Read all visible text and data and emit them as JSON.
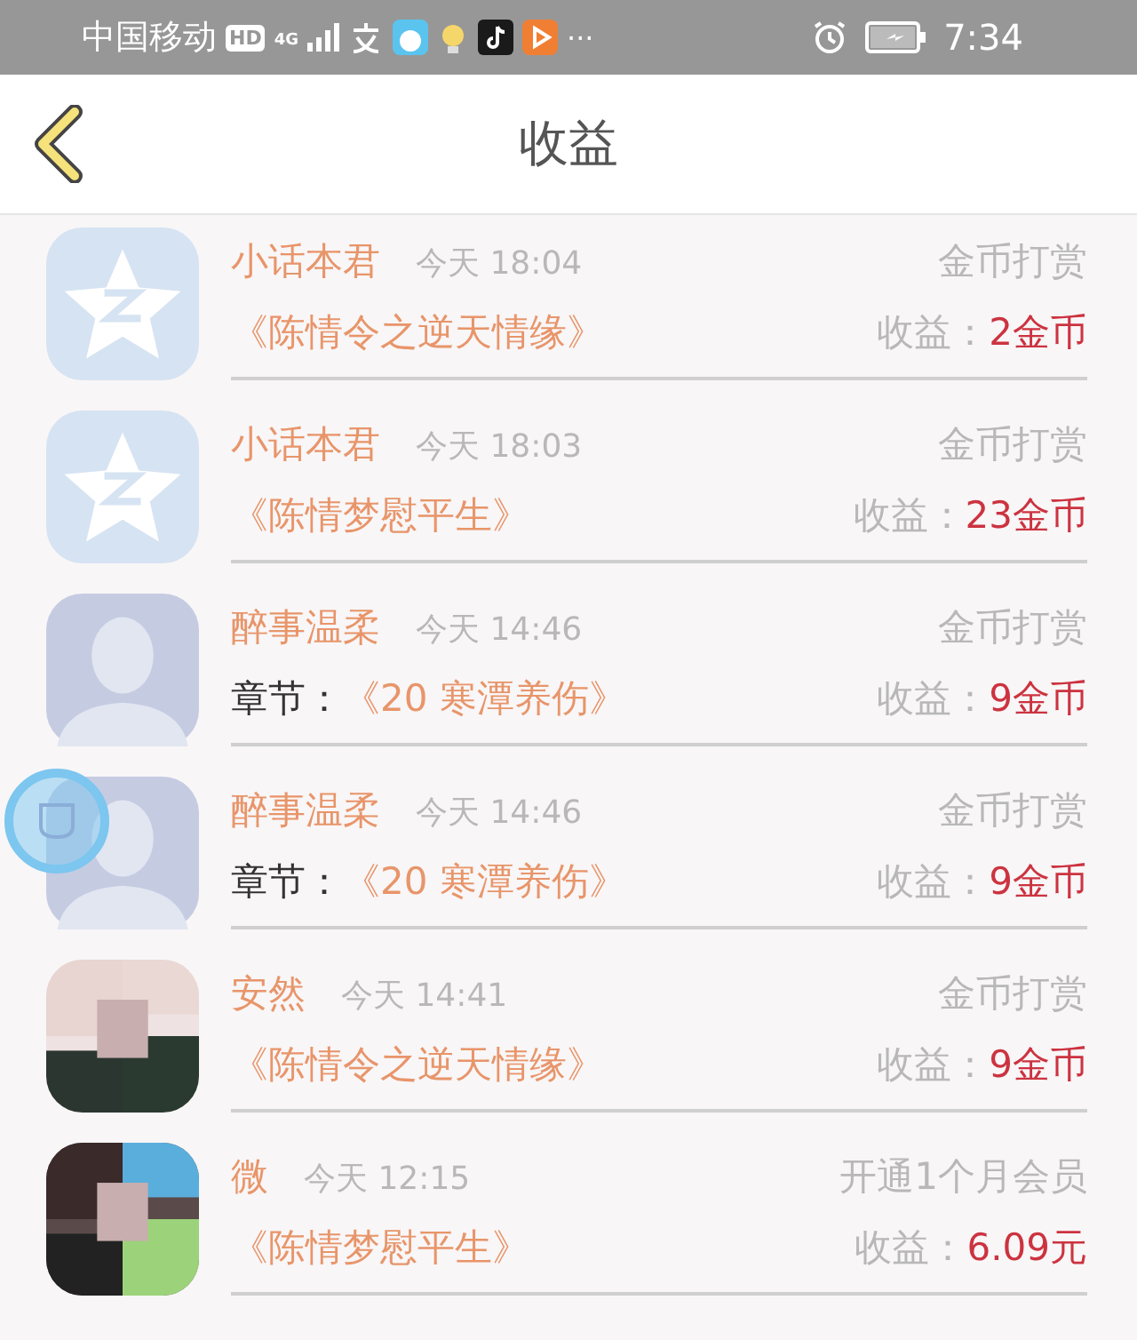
{
  "status_bar": {
    "carrier": "中国移动",
    "hd": "HD",
    "network": "4G",
    "more": "···",
    "time": "7:34"
  },
  "header": {
    "title": "收益"
  },
  "rows": [
    {
      "avatar": {
        "kind": "star"
      },
      "name": "小话本君",
      "time": "今天 18:04",
      "type": "金币打赏",
      "title": "《陈情令之逆天情缘》",
      "earnings_label": "收益：",
      "amount": "2金币"
    },
    {
      "avatar": {
        "kind": "star"
      },
      "name": "小话本君",
      "time": "今天 18:03",
      "type": "金币打赏",
      "title": "《陈情梦慰平生》",
      "earnings_label": "收益：",
      "amount": "23金币"
    },
    {
      "avatar": {
        "kind": "silhouette"
      },
      "name": "醉事温柔",
      "time": "今天 14:46",
      "type": "金币打赏",
      "prefix": "章节：",
      "title": "《20 寒潭养伤》",
      "earnings_label": "收益：",
      "amount": "9金币"
    },
    {
      "avatar": {
        "kind": "silhouette"
      },
      "name": "醉事温柔",
      "time": "今天 14:46",
      "type": "金币打赏",
      "prefix": "章节：",
      "title": "《20 寒潭养伤》",
      "earnings_label": "收益：",
      "amount": "9金币"
    },
    {
      "name": "安然",
      "time": "今天 14:41",
      "type": "金币打赏",
      "title": "《陈情令之逆天情缘》",
      "earnings_label": "收益：",
      "amount": "9金币"
    },
    {
      "name": "微",
      "time": "今天 12:15",
      "type": "开通1个月会员",
      "title": "《陈情梦慰平生》",
      "earnings_label": "收益：",
      "amount": "6.09元"
    }
  ]
}
